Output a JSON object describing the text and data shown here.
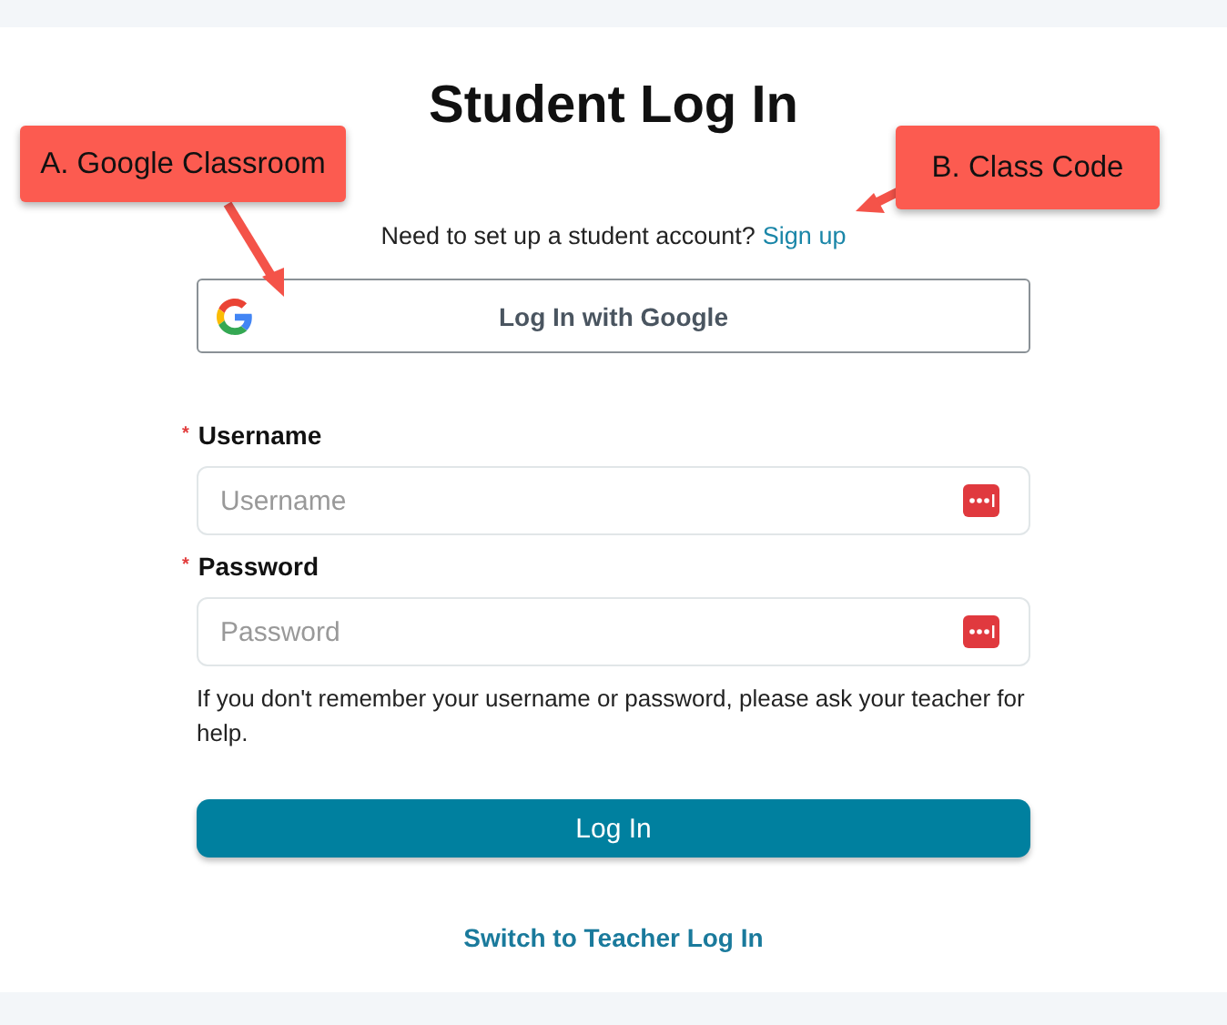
{
  "title": "Student Log In",
  "signup": {
    "prompt": "Need to set up a student account?",
    "link": "Sign up"
  },
  "google_button": "Log In with Google",
  "fields": [
    {
      "label": "Username",
      "placeholder": "Username",
      "required_mark": "*"
    },
    {
      "label": "Password",
      "placeholder": "Password",
      "required_mark": "*"
    }
  ],
  "help_text": "If you don't remember your username or password, please ask your teacher for help.",
  "login_button": "Log In",
  "switch_link": "Switch to Teacher Log In",
  "callouts": [
    {
      "label": "A. Google Classroom"
    },
    {
      "label": "B. Class Code"
    }
  ]
}
